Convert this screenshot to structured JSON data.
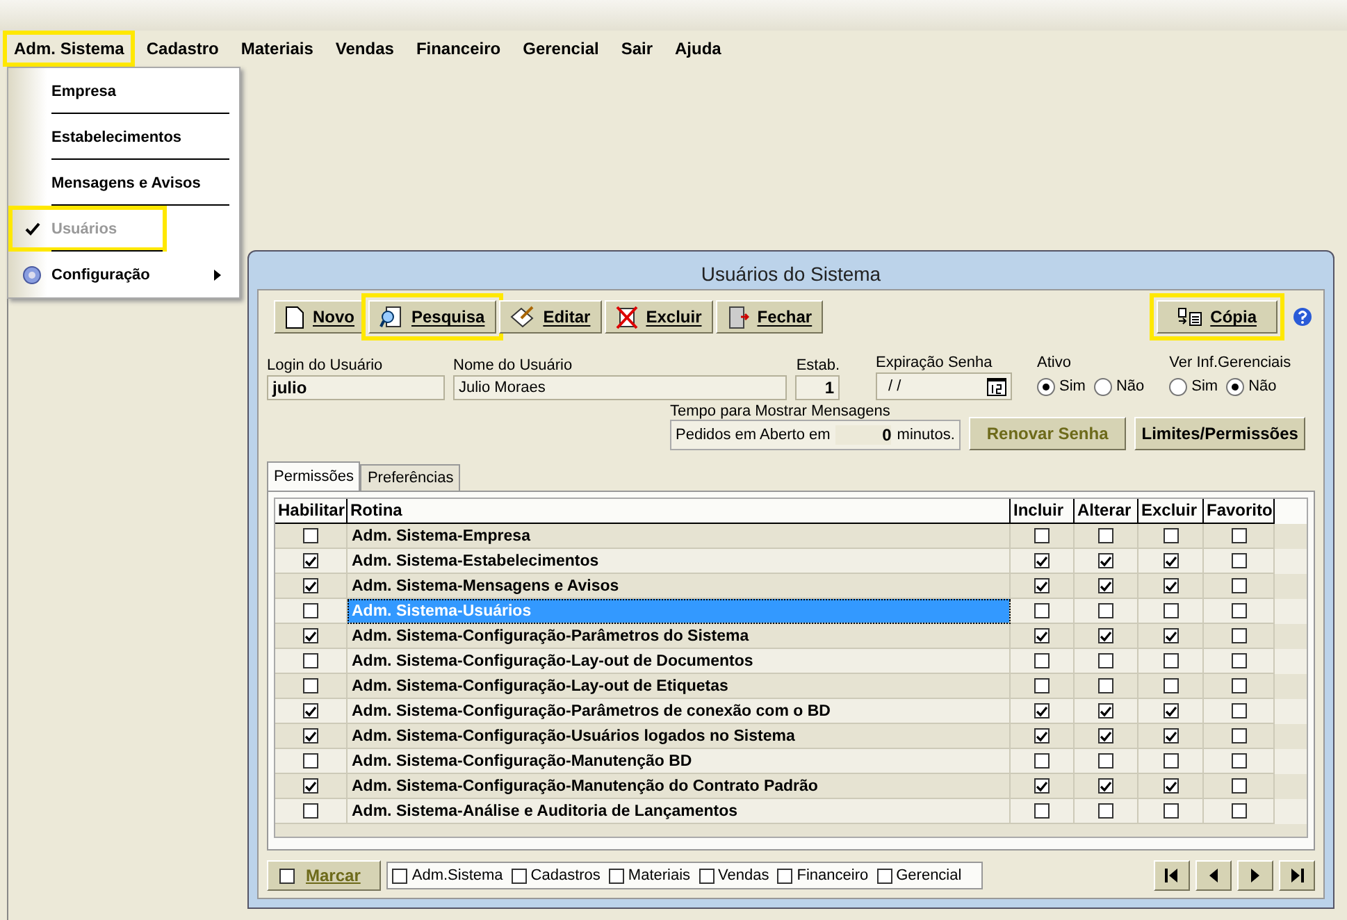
{
  "menu_bar": {
    "items": [
      {
        "label": "Adm. Sistema",
        "highlighted": true
      },
      {
        "label": "Cadastro",
        "highlighted": false
      },
      {
        "label": "Materiais",
        "highlighted": false
      },
      {
        "label": "Vendas",
        "highlighted": false
      },
      {
        "label": "Financeiro",
        "highlighted": false
      },
      {
        "label": "Gerencial",
        "highlighted": false
      },
      {
        "label": "Sair",
        "highlighted": false
      },
      {
        "label": "Ajuda",
        "highlighted": false
      }
    ]
  },
  "dropdown": {
    "items": [
      {
        "label": "Empresa",
        "kind": "item",
        "checked": false,
        "disabled": false,
        "highlighted": false
      },
      {
        "label": "Estabelecimentos",
        "kind": "item",
        "checked": false,
        "disabled": false,
        "highlighted": false
      },
      {
        "label": "Mensagens e Avisos",
        "kind": "item",
        "checked": false,
        "disabled": false,
        "highlighted": false
      },
      {
        "label": "Usuários",
        "kind": "item",
        "checked": true,
        "disabled": true,
        "highlighted": true
      },
      {
        "label": "Configuração",
        "kind": "submenu",
        "checked": false,
        "disabled": false,
        "highlighted": false
      }
    ]
  },
  "dialog": {
    "title": "Usuários do Sistema",
    "toolbar": [
      {
        "label": "Novo",
        "highlighted": false
      },
      {
        "label": "Pesquisa",
        "highlighted": true
      },
      {
        "label": "Editar",
        "highlighted": false
      },
      {
        "label": "Excluir",
        "highlighted": false
      },
      {
        "label": "Fechar",
        "highlighted": false
      }
    ],
    "copy_button": {
      "label": "Cópia",
      "highlighted": true
    },
    "login": {
      "label": "Login do Usuário",
      "value": "julio"
    },
    "name": {
      "label": "Nome do Usuário",
      "value": "Julio Moraes"
    },
    "estab": {
      "label": "Estab.",
      "value": "1"
    },
    "expiration": {
      "label": "Expiração Senha",
      "value": "/ /"
    },
    "ativo": {
      "label": "Ativo",
      "options": [
        {
          "label": "Sim",
          "selected": true
        },
        {
          "label": "Não",
          "selected": false
        }
      ]
    },
    "ver_inf": {
      "label": "Ver Inf.Gerenciais",
      "options": [
        {
          "label": "Sim",
          "selected": false
        },
        {
          "label": "Não",
          "selected": true
        }
      ]
    },
    "message_time": {
      "label": "Tempo para Mostrar Mensagens",
      "prefix": "Pedidos em Aberto em",
      "value": "0",
      "suffix": "minutos."
    },
    "renew_button": {
      "label": "Renovar Senha",
      "disabled": true
    },
    "limits_button": {
      "label": "Limites/Permissões",
      "disabled": false
    },
    "tabs": [
      {
        "label": "Permissões",
        "selected": true
      },
      {
        "label": "Preferências",
        "selected": false
      }
    ],
    "table": {
      "columns": [
        "Habilitar",
        "Rotina",
        "Incluir",
        "Alterar",
        "Excluir",
        "Favorito"
      ],
      "rows": [
        {
          "enabled": false,
          "routine": "Adm. Sistema-Empresa",
          "include": false,
          "change": false,
          "delete": false,
          "favorite": false,
          "selected": false
        },
        {
          "enabled": true,
          "routine": "Adm. Sistema-Estabelecimentos",
          "include": true,
          "change": true,
          "delete": true,
          "favorite": false,
          "selected": false
        },
        {
          "enabled": true,
          "routine": "Adm. Sistema-Mensagens e Avisos",
          "include": true,
          "change": true,
          "delete": true,
          "favorite": false,
          "selected": false
        },
        {
          "enabled": false,
          "routine": "Adm. Sistema-Usuários",
          "include": false,
          "change": false,
          "delete": false,
          "favorite": false,
          "selected": true
        },
        {
          "enabled": true,
          "routine": "Adm. Sistema-Configuração-Parâmetros do Sistema",
          "include": true,
          "change": true,
          "delete": true,
          "favorite": false,
          "selected": false
        },
        {
          "enabled": false,
          "routine": "Adm. Sistema-Configuração-Lay-out de Documentos",
          "include": false,
          "change": false,
          "delete": false,
          "favorite": false,
          "selected": false
        },
        {
          "enabled": false,
          "routine": "Adm. Sistema-Configuração-Lay-out de Etiquetas",
          "include": false,
          "change": false,
          "delete": false,
          "favorite": false,
          "selected": false
        },
        {
          "enabled": true,
          "routine": "Adm. Sistema-Configuração-Parâmetros de conexão com o BD",
          "include": true,
          "change": true,
          "delete": true,
          "favorite": false,
          "selected": false
        },
        {
          "enabled": true,
          "routine": "Adm. Sistema-Configuração-Usuários logados no Sistema",
          "include": true,
          "change": true,
          "delete": true,
          "favorite": false,
          "selected": false
        },
        {
          "enabled": false,
          "routine": "Adm. Sistema-Configuração-Manutenção BD",
          "include": false,
          "change": false,
          "delete": false,
          "favorite": false,
          "selected": false
        },
        {
          "enabled": true,
          "routine": "Adm. Sistema-Configuração-Manutenção do Contrato Padrão",
          "include": true,
          "change": true,
          "delete": true,
          "favorite": false,
          "selected": false
        },
        {
          "enabled": false,
          "routine": "Adm. Sistema-Análise e Auditoria de Lançamentos",
          "include": false,
          "change": false,
          "delete": false,
          "favorite": false,
          "selected": false
        }
      ]
    },
    "mark_button": {
      "label": "Marcar",
      "checked": false
    },
    "filters": [
      {
        "label": "Adm.Sistema",
        "checked": false
      },
      {
        "label": "Cadastros",
        "checked": false
      },
      {
        "label": "Materiais",
        "checked": false
      },
      {
        "label": "Vendas",
        "checked": false
      },
      {
        "label": "Financeiro",
        "checked": false
      },
      {
        "label": "Gerencial",
        "checked": false
      }
    ],
    "nav_buttons": [
      {
        "kind": "first"
      },
      {
        "kind": "prev"
      },
      {
        "kind": "next"
      },
      {
        "kind": "last"
      }
    ]
  }
}
